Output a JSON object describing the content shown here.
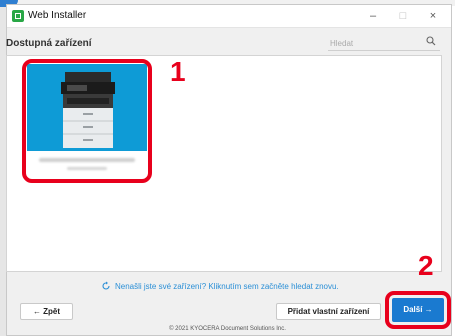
{
  "window": {
    "title": "Web Installer",
    "controls": {
      "minimize": "–",
      "maximize": "□",
      "close": "×"
    }
  },
  "header": {
    "section_title": "Dostupná zařízení",
    "search_placeholder": "Hledat"
  },
  "device_card": {
    "name": "",
    "model": ""
  },
  "annotations": {
    "step1": "1",
    "step2": "2"
  },
  "help_link": "Nenašli jste své zařízení? Kliknutím sem začněte hledat znovu.",
  "buttons": {
    "back": "← Zpět",
    "add_device": "Přidat vlastní zařízení",
    "next": "Další →"
  },
  "footer": "© 2021 KYOCERA Document Solutions Inc.",
  "colors": {
    "accent": "#1a7ad0",
    "annotation": "#e8001c",
    "card": "#0e9bd6"
  }
}
